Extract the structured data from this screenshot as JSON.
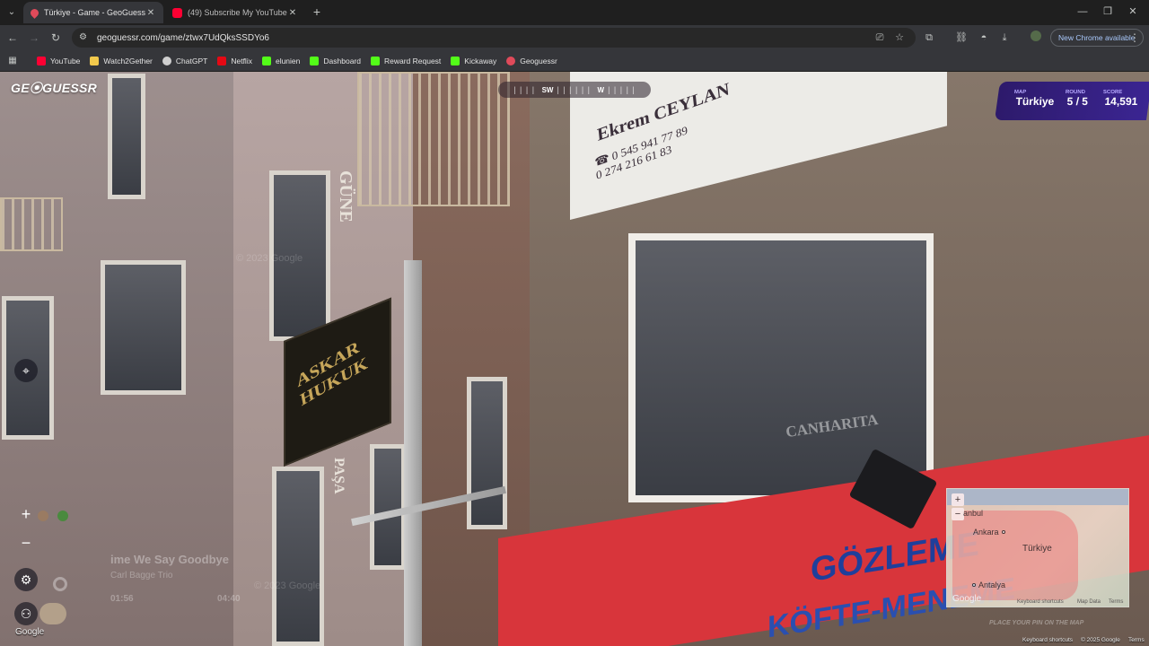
{
  "browser": {
    "tabs": [
      {
        "title": "Türkiye - Game - GeoGuessr",
        "active": true
      },
      {
        "title": "(49) Subscribe My YouTube Cha",
        "active": false
      }
    ],
    "url": "geoguessr.com/game/ztwx7UdQksSSDYo6",
    "new_chrome_label": "New Chrome available",
    "bookmarks": [
      "YouTube",
      "Watch2Gether",
      "ChatGPT",
      "Netflix",
      "elunien",
      "Dashboard",
      "Reward Request",
      "Kickaway",
      "Geoguessr"
    ]
  },
  "game": {
    "logo": "GE⦿GUESSR",
    "compass": {
      "left": "SW",
      "right": "W"
    },
    "status": {
      "map_label": "MAP",
      "map_value": "Türkiye",
      "round_label": "ROUND",
      "round_value": "5 / 5",
      "score_label": "SCORE",
      "score_value": "14,591"
    },
    "music": {
      "title": "ime We Say Goodbye",
      "artist": "Carl Bagge Trio",
      "elapsed": "01:56",
      "total": "04:40"
    },
    "google_mark": "Google",
    "street_watermark_1": "© 2023 Google",
    "street_watermark_2": "© 2023 Google",
    "signs": {
      "ceylan_name": "Ekrem CEYLAN",
      "ceylan_phone1": "☎ 0 545 941 77 89",
      "ceylan_phone2": "0 274 216 61 83",
      "askar": "ASKAR HUKUK",
      "gozleme": "GÖZLEME",
      "kofte": "KÖFTE-MENEME",
      "vertical_gunes": "GÜNE",
      "vertical_pasa": "PAŞA",
      "canharita": "CANHARITA"
    },
    "minimap": {
      "cities": [
        "anbul",
        "Ankara",
        "Türkiye",
        "Antalya"
      ],
      "google": "Google",
      "attr": [
        "Keyboard shortcuts",
        "Map Data",
        "Terms"
      ]
    },
    "place_pin": "PLACE YOUR PIN ON THE MAP",
    "bottom_attr": [
      "Keyboard shortcuts",
      "© 2025 Google",
      "Terms"
    ]
  }
}
